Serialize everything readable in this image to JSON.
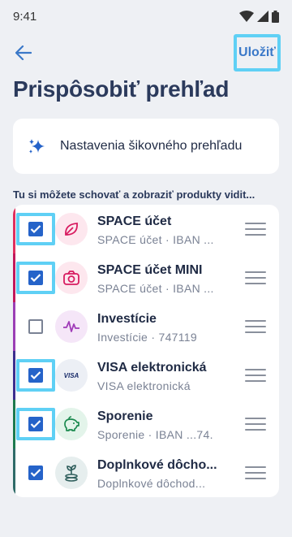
{
  "status_bar": {
    "time": "9:41"
  },
  "topbar": {
    "save_label": "Uložiť"
  },
  "page": {
    "title": "Prispôsobiť prehľad"
  },
  "smart_card": {
    "label": "Nastavenia šikovného prehľadu"
  },
  "section": {
    "label": "Tu si môžete schovať a zobraziť produkty vidit..."
  },
  "colors": {
    "accent_blue": "#2563c9",
    "link_blue": "#3a78c8",
    "title": "#2b3a5c"
  },
  "products": [
    {
      "name": "SPACE účet",
      "subtitle": "SPACE účet · IBAN ...",
      "checked": true,
      "icon": "leaf-icon",
      "accent": "#e0305e"
    },
    {
      "name": "SPACE účet MINI",
      "subtitle": "SPACE účet · IBAN ...",
      "checked": true,
      "icon": "camera-icon",
      "accent": "#c2185b"
    },
    {
      "name": "Investície",
      "subtitle": "Investície · 747119",
      "checked": false,
      "icon": "pulse-icon",
      "accent": "#9b3fb5"
    },
    {
      "name": "VISA elektronická",
      "subtitle": "VISA elektronická",
      "checked": true,
      "icon": "visa-card-icon",
      "icon_text": "VISA",
      "accent": "#3d2f8f"
    },
    {
      "name": "Sporenie",
      "subtitle": "Sporenie · IBAN ...74.",
      "checked": true,
      "icon": "piggy-bank-icon",
      "accent": "#1d7a4e"
    },
    {
      "name": "Doplnkové dôcho...",
      "subtitle": "Doplnkové dôchod...",
      "checked": true,
      "icon": "plant-coins-icon",
      "accent": "#2f6b68"
    }
  ]
}
